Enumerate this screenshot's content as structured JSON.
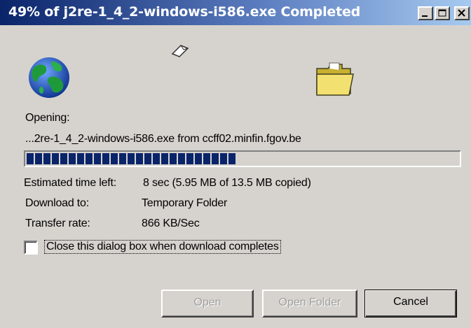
{
  "window": {
    "title": "49% of j2re-1_4_2-windows-i586.exe Completed",
    "controls": [
      "minimize-icon",
      "maximize-icon",
      "close-icon"
    ]
  },
  "animation": {
    "icons": [
      "globe-icon",
      "paper-icon",
      "folder-icon"
    ]
  },
  "status": {
    "opening_label": "Opening:",
    "file_source": "...2re-1_4_2-windows-i586.exe from ccff02.minfin.fgov.be",
    "progress_fraction": 0.49
  },
  "details": [
    {
      "label": "Estimated time left:",
      "value": "8 sec (5.95 MB of 13.5 MB copied)"
    },
    {
      "label": "Download to:",
      "value": "Temporary Folder"
    },
    {
      "label": "Transfer rate:",
      "value": "866 KB/Sec"
    }
  ],
  "options": {
    "close_on_complete_label": "Close this dialog box when download completes",
    "close_on_complete_checked": false
  },
  "buttons": {
    "open": "Open",
    "open_folder": "Open Folder",
    "cancel": "Cancel"
  },
  "colors": {
    "title_start": "#0a246a",
    "title_end": "#a6caf0",
    "progress": "#0a246a",
    "face": "#d6d3ce"
  }
}
